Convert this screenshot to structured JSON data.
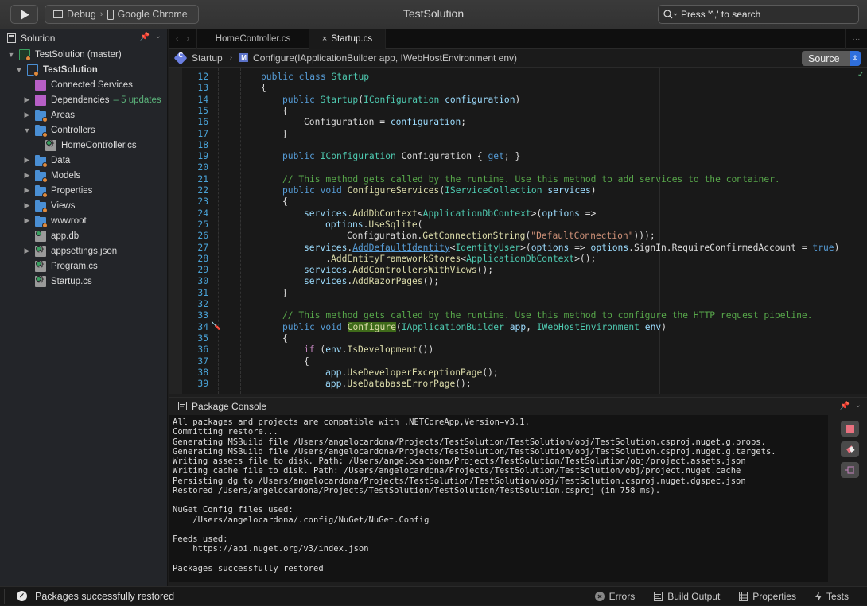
{
  "toolbar": {
    "run_icon": "play-icon",
    "config": "Debug",
    "target": "Google Chrome",
    "title": "TestSolution",
    "search_placeholder": "Press '^,' to search"
  },
  "sidebar": {
    "title": "Solution",
    "tree": [
      {
        "label": "TestSolution (master)",
        "level": 0,
        "twisty": "open",
        "icon": "solution-icon",
        "bold": false
      },
      {
        "label": "TestSolution",
        "level": 1,
        "twisty": "open",
        "icon": "project-icon",
        "bold": true
      },
      {
        "label": "Connected Services",
        "level": 2,
        "twisty": "none",
        "icon": "connected-services-icon"
      },
      {
        "label": "Dependencies",
        "level": 2,
        "twisty": "closed",
        "icon": "dependencies-icon",
        "extra": "– 5 updates"
      },
      {
        "label": "Areas",
        "level": 2,
        "twisty": "closed",
        "icon": "folder-icon"
      },
      {
        "label": "Controllers",
        "level": 2,
        "twisty": "open",
        "icon": "folder-icon"
      },
      {
        "label": "HomeController.cs",
        "level": 3,
        "twisty": "none",
        "icon": "cs-file-icon"
      },
      {
        "label": "Data",
        "level": 2,
        "twisty": "closed",
        "icon": "folder-icon"
      },
      {
        "label": "Models",
        "level": 2,
        "twisty": "closed",
        "icon": "folder-icon"
      },
      {
        "label": "Properties",
        "level": 2,
        "twisty": "closed",
        "icon": "folder-icon"
      },
      {
        "label": "Views",
        "level": 2,
        "twisty": "closed",
        "icon": "folder-icon"
      },
      {
        "label": "wwwroot",
        "level": 2,
        "twisty": "closed",
        "icon": "folder-icon"
      },
      {
        "label": "app.db",
        "level": 2,
        "twisty": "none",
        "icon": "file-icon"
      },
      {
        "label": "appsettings.json",
        "level": 2,
        "twisty": "closed",
        "icon": "json-file-icon"
      },
      {
        "label": "Program.cs",
        "level": 2,
        "twisty": "none",
        "icon": "cs-file-icon"
      },
      {
        "label": "Startup.cs",
        "level": 2,
        "twisty": "none",
        "icon": "cs-file-icon"
      }
    ]
  },
  "tabs": [
    {
      "label": "HomeController.cs",
      "active": false
    },
    {
      "label": "Startup.cs",
      "active": true
    }
  ],
  "breadcrumb": {
    "class_name": "Startup",
    "method": "Configure(IApplicationBuilder app, IWebHostEnvironment env)",
    "view_mode": "Source"
  },
  "editor": {
    "lines": [
      {
        "n": "12",
        "html": "<span class=\"k\">public</span> <span class=\"k\">class</span> <span class=\"t\">Startup</span>",
        "indent": 0
      },
      {
        "n": "13",
        "html": "{",
        "indent": 0
      },
      {
        "n": "14",
        "html": "<span class=\"k\">public</span> <span class=\"t\">Startup</span>(<span class=\"t\">IConfiguration</span> <span class=\"v\">configuration</span>)",
        "indent": 1
      },
      {
        "n": "15",
        "html": "{",
        "indent": 1
      },
      {
        "n": "16",
        "html": "Configuration = <span class=\"v\">configuration</span>;",
        "indent": 2
      },
      {
        "n": "17",
        "html": "}",
        "indent": 1
      },
      {
        "n": "18",
        "html": "",
        "indent": 0
      },
      {
        "n": "19",
        "html": "<span class=\"k\">public</span> <span class=\"t\">IConfiguration</span> Configuration { <span class=\"k\">get</span>; }",
        "indent": 1
      },
      {
        "n": "20",
        "html": "",
        "indent": 0
      },
      {
        "n": "21",
        "html": "<span class=\"c\">// This method gets called by the runtime. Use this method to add services to the container.</span>",
        "indent": 1
      },
      {
        "n": "22",
        "html": "<span class=\"k\">public</span> <span class=\"k\">void</span> <span class=\"m\">ConfigureServices</span>(<span class=\"t\">IServiceCollection</span> <span class=\"v\">services</span>)",
        "indent": 1
      },
      {
        "n": "23",
        "html": "{",
        "indent": 1
      },
      {
        "n": "24",
        "html": "<span class=\"v\">services</span>.<span class=\"m\">AddDbContext</span>&lt;<span class=\"t\">ApplicationDbContext</span>&gt;(<span class=\"v\">options</span> =&gt;",
        "indent": 2
      },
      {
        "n": "25",
        "html": "<span class=\"v\">options</span>.<span class=\"m\">UseSqlite</span>(",
        "indent": 3
      },
      {
        "n": "26",
        "html": "Configuration.<span class=\"m\">GetConnectionString</span>(<span class=\"s\">\"DefaultConnection\"</span>)));",
        "indent": 4
      },
      {
        "n": "27",
        "html": "<span class=\"v\">services</span>.<span class=\"u\">AddDefaultIdentity</span>&lt;<span class=\"t\">IdentityUser</span>&gt;(<span class=\"v\">options</span> =&gt; <span class=\"v\">options</span>.SignIn.RequireConfirmedAccount = <span class=\"k\">true</span>)",
        "indent": 2
      },
      {
        "n": "28",
        "html": "    .<span class=\"m\">AddEntityFrameworkStores</span>&lt;<span class=\"t\">ApplicationDbContext</span>&gt;();",
        "indent": 2
      },
      {
        "n": "29",
        "html": "<span class=\"v\">services</span>.<span class=\"m\">AddControllersWithViews</span>();",
        "indent": 2
      },
      {
        "n": "30",
        "html": "<span class=\"v\">services</span>.<span class=\"m\">AddRazorPages</span>();",
        "indent": 2
      },
      {
        "n": "31",
        "html": "}",
        "indent": 1
      },
      {
        "n": "32",
        "html": "",
        "indent": 0
      },
      {
        "n": "33",
        "html": "<span class=\"c\">// This method gets called by the runtime. Use this method to configure the HTTP request pipeline.</span>",
        "indent": 1
      },
      {
        "n": "34",
        "html": "<span class=\"k\">public</span> <span class=\"k\">void</span> <span class=\"m hl\">Configure</span>(<span class=\"t\">IApplicationBuilder</span> <span class=\"v\">app</span>, <span class=\"t\">IWebHostEnvironment</span> <span class=\"v\">env</span>)",
        "indent": 1
      },
      {
        "n": "35",
        "html": "{",
        "indent": 1
      },
      {
        "n": "36",
        "html": "<span class=\"p\">if</span> (<span class=\"v\">env</span>.<span class=\"m\">IsDevelopment</span>())",
        "indent": 2
      },
      {
        "n": "37",
        "html": "{",
        "indent": 2
      },
      {
        "n": "38",
        "html": "<span class=\"v\">app</span>.<span class=\"m\">UseDeveloperExceptionPage</span>();",
        "indent": 3
      },
      {
        "n": "39",
        "html": "<span class=\"v\">app</span>.<span class=\"m\">UseDatabaseErrorPage</span>();",
        "indent": 3
      }
    ]
  },
  "console": {
    "title": "Package Console",
    "output": [
      "All packages and projects are compatible with .NETCoreApp,Version=v3.1.",
      "Committing restore...",
      "Generating MSBuild file /Users/angelocardona/Projects/TestSolution/TestSolution/obj/TestSolution.csproj.nuget.g.props.",
      "Generating MSBuild file /Users/angelocardona/Projects/TestSolution/TestSolution/obj/TestSolution.csproj.nuget.g.targets.",
      "Writing assets file to disk. Path: /Users/angelocardona/Projects/TestSolution/TestSolution/obj/project.assets.json",
      "Writing cache file to disk. Path: /Users/angelocardona/Projects/TestSolution/TestSolution/obj/project.nuget.cache",
      "Persisting dg to /Users/angelocardona/Projects/TestSolution/TestSolution/obj/TestSolution.csproj.nuget.dgspec.json",
      "Restored /Users/angelocardona/Projects/TestSolution/TestSolution/TestSolution.csproj (in 758 ms).",
      "",
      "NuGet Config files used:",
      "    /Users/angelocardona/.config/NuGet/NuGet.Config",
      "",
      "Feeds used:",
      "    https://api.nuget.org/v3/index.json",
      "",
      "Packages successfully restored"
    ],
    "buttons": [
      "stop-button",
      "clear-button",
      "pin-button"
    ]
  },
  "statusbar": {
    "message": "Packages successfully restored",
    "pads": [
      {
        "label": "Errors",
        "icon": "error-icon"
      },
      {
        "label": "Build Output",
        "icon": "build-output-icon"
      },
      {
        "label": "Properties",
        "icon": "properties-icon"
      },
      {
        "label": "Tests",
        "icon": "lightning-icon"
      }
    ]
  },
  "colors": {
    "accent": "#2f6fdc",
    "comment": "#57a64a",
    "keyword": "#569cd6",
    "type": "#4ec9b0",
    "method": "#dcdcaa",
    "string": "#ce9178",
    "update_badge": "#5bb27a"
  }
}
